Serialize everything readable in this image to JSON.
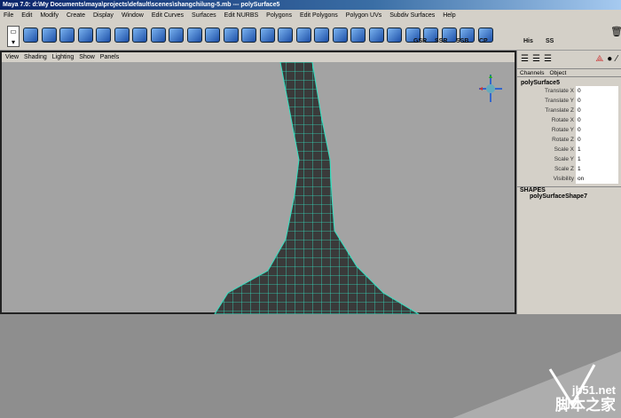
{
  "title": "Maya 7.0: d:\\My Documents\\maya\\projects\\default\\scenes\\shangchilung-5.mb  ---  polySurface5",
  "menu": [
    "File",
    "Edit",
    "Modify",
    "Create",
    "Display",
    "Window",
    "Edit Curves",
    "Surfaces",
    "Edit NURBS",
    "Polygons",
    "Edit Polygons",
    "Polygon UVs",
    "Subdiv Surfaces",
    "Help"
  ],
  "shelf_labels": [
    "GSR",
    "SSR",
    "SSB",
    "CP",
    "His",
    "SS"
  ],
  "viewport_menu": [
    "View",
    "Shading",
    "Lighting",
    "Show",
    "Panels"
  ],
  "channel_tabs": [
    "Channels",
    "Object"
  ],
  "object": "polySurface5",
  "channels": [
    {
      "label": "Translate X",
      "value": "0"
    },
    {
      "label": "Translate Y",
      "value": "0"
    },
    {
      "label": "Translate Z",
      "value": "0"
    },
    {
      "label": "Rotate X",
      "value": "0"
    },
    {
      "label": "Rotate Y",
      "value": "0"
    },
    {
      "label": "Rotate Z",
      "value": "0"
    },
    {
      "label": "Scale X",
      "value": "1"
    },
    {
      "label": "Scale Y",
      "value": "1"
    },
    {
      "label": "Scale Z",
      "value": "1"
    },
    {
      "label": "Visibility",
      "value": "on"
    }
  ],
  "shapes_header": "SHAPES",
  "shape_name": "polySurfaceShape7",
  "watermark": {
    "site": "jb51.net",
    "name": "脚本之家"
  },
  "colors": {
    "wire": "#33e0c0",
    "mesh": "#3a3a3a",
    "viewport": "#a3a3a3"
  }
}
